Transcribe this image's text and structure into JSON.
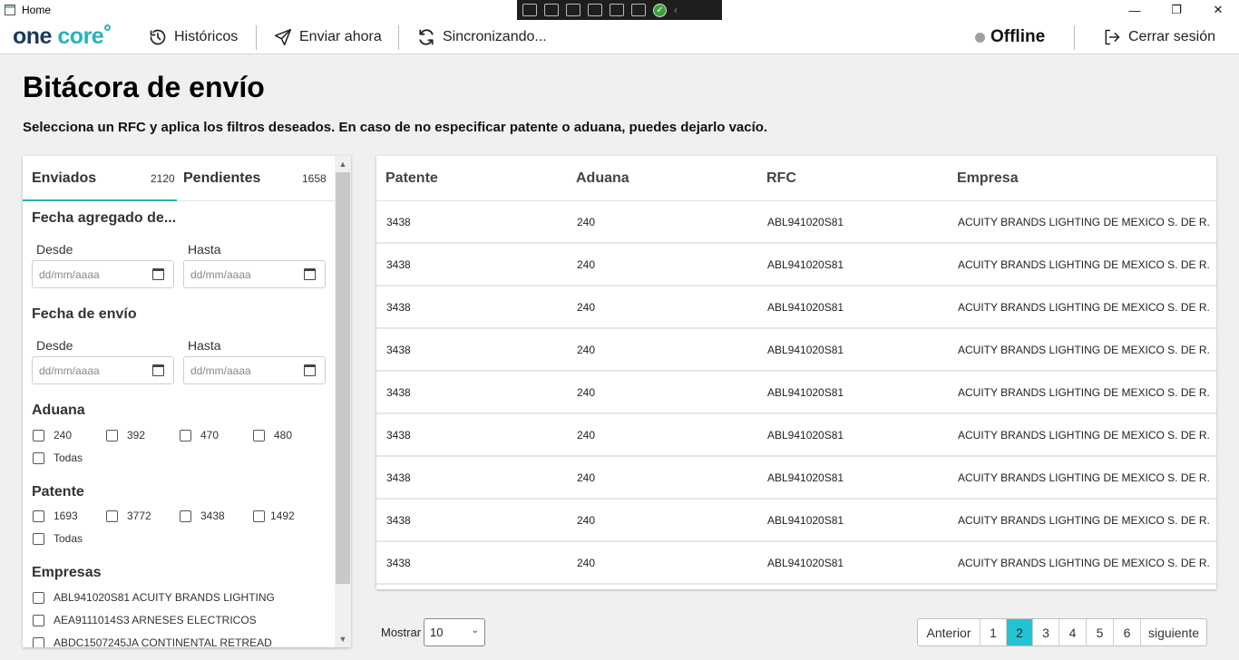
{
  "window": {
    "title": "Home"
  },
  "header": {
    "logo_one": "one",
    "logo_core": "core",
    "nav": {
      "historicos": "Históricos",
      "enviar": "Enviar ahora",
      "sync": "Sincronizando..."
    },
    "status": "Offline",
    "logout": "Cerrar sesión"
  },
  "page": {
    "title": "Bitácora de envío",
    "subtitle": "Selecciona un RFC y aplica los filtros deseados. En caso de no especificar patente o aduana, puedes dejarlo vacío."
  },
  "filters": {
    "tabs": [
      {
        "label": "Enviados",
        "count": "2120"
      },
      {
        "label": "Pendientes",
        "count": "1658"
      }
    ],
    "fecha_agregado": {
      "title": "Fecha agregado de...",
      "desde": "Desde",
      "hasta": "Hasta",
      "placeholder": "dd/mm/aaaa"
    },
    "fecha_envio": {
      "title": "Fecha de envío",
      "desde": "Desde",
      "hasta": "Hasta",
      "placeholder": "dd/mm/aaaa"
    },
    "aduana": {
      "title": "Aduana",
      "options": [
        "240",
        "392",
        "470",
        "480"
      ],
      "all": "Todas"
    },
    "patente": {
      "title": "Patente",
      "options": [
        "1693",
        "3772",
        "3438",
        "1492"
      ],
      "all": "Todas"
    },
    "empresas": {
      "title": "Empresas",
      "items": [
        "ABL941020S81 ACUITY BRANDS LIGHTING",
        "AEA9111014S3 ARNESES ELECTRICOS",
        "ABDC1507245JA CONTINENTAL RETREAD"
      ]
    }
  },
  "table": {
    "columns": [
      "Patente",
      "Aduana",
      "RFC",
      "Empresa"
    ],
    "rows": [
      [
        "3438",
        "240",
        "ABL941020S81",
        "ACUITY BRANDS LIGHTING DE MEXICO S. DE R."
      ],
      [
        "3438",
        "240",
        "ABL941020S81",
        "ACUITY BRANDS LIGHTING DE MEXICO S. DE R."
      ],
      [
        "3438",
        "240",
        "ABL941020S81",
        "ACUITY BRANDS LIGHTING DE MEXICO S. DE R."
      ],
      [
        "3438",
        "240",
        "ABL941020S81",
        "ACUITY BRANDS LIGHTING DE MEXICO S. DE R."
      ],
      [
        "3438",
        "240",
        "ABL941020S81",
        "ACUITY BRANDS LIGHTING DE MEXICO S. DE R."
      ],
      [
        "3438",
        "240",
        "ABL941020S81",
        "ACUITY BRANDS LIGHTING DE MEXICO S. DE R."
      ],
      [
        "3438",
        "240",
        "ABL941020S81",
        "ACUITY BRANDS LIGHTING DE MEXICO S. DE R."
      ],
      [
        "3438",
        "240",
        "ABL941020S81",
        "ACUITY BRANDS LIGHTING DE MEXICO S. DE R."
      ],
      [
        "3438",
        "240",
        "ABL941020S81",
        "ACUITY BRANDS LIGHTING DE MEXICO S. DE R."
      ]
    ]
  },
  "footer": {
    "show_label": "Mostrar",
    "page_size": "10",
    "prev": "Anterior",
    "pages": [
      "1",
      "2",
      "3",
      "4",
      "5",
      "6"
    ],
    "current_page": "2",
    "next": "siguiente"
  },
  "colors": {
    "accent": "#22b3c0",
    "active_page": "#22c4d4",
    "brand_dark": "#1a3a5a",
    "status_offline": "#a0a0a0"
  },
  "icons": {
    "historicos": "history-icon",
    "enviar": "send-icon",
    "sync": "sync-icon",
    "logout": "logout-icon",
    "calendar": "calendar-icon"
  }
}
